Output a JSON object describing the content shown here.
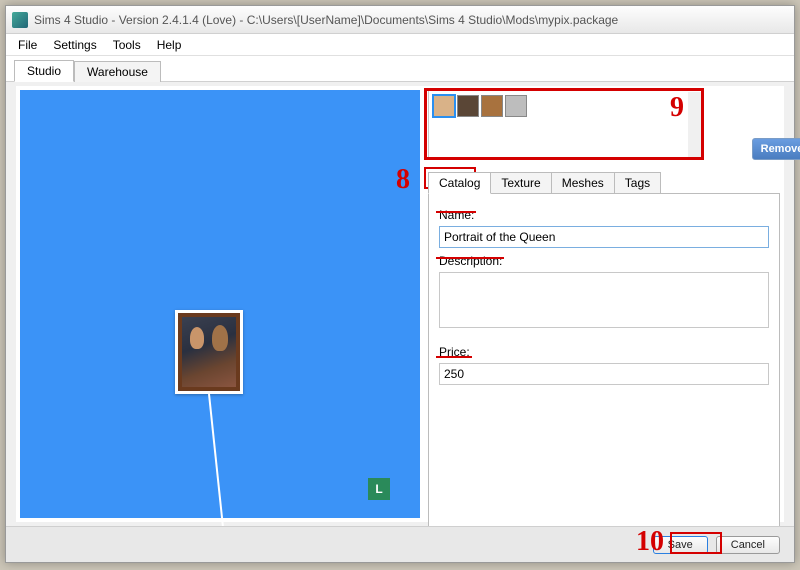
{
  "title": "Sims 4 Studio - Version 2.4.1.4  (Love)   - C:\\Users\\[UserName]\\Documents\\Sims 4 Studio\\Mods\\mypix.package",
  "menu": {
    "file": "File",
    "settings": "Settings",
    "tools": "Tools",
    "help": "Help"
  },
  "top_tabs": {
    "studio": "Studio",
    "warehouse": "Warehouse"
  },
  "viewport_badge": "L",
  "swatches": {
    "colors": [
      "#d9b288",
      "#5a4636",
      "#a8723e",
      "#bdbdbd"
    ],
    "selected_index": 0
  },
  "buttons": {
    "remove_swatch": "Remove Swatch",
    "save": "Save",
    "cancel": "Cancel"
  },
  "prop_tabs": {
    "catalog": "Catalog",
    "texture": "Texture",
    "meshes": "Meshes",
    "tags": "Tags"
  },
  "catalog": {
    "name_label": "Name:",
    "name_value": "Portrait of the Queen",
    "desc_label": "Description:",
    "desc_value": "",
    "price_label": "Price:",
    "price_value": "250"
  },
  "annotations": {
    "n8": "8",
    "n9": "9",
    "n10": "10"
  }
}
